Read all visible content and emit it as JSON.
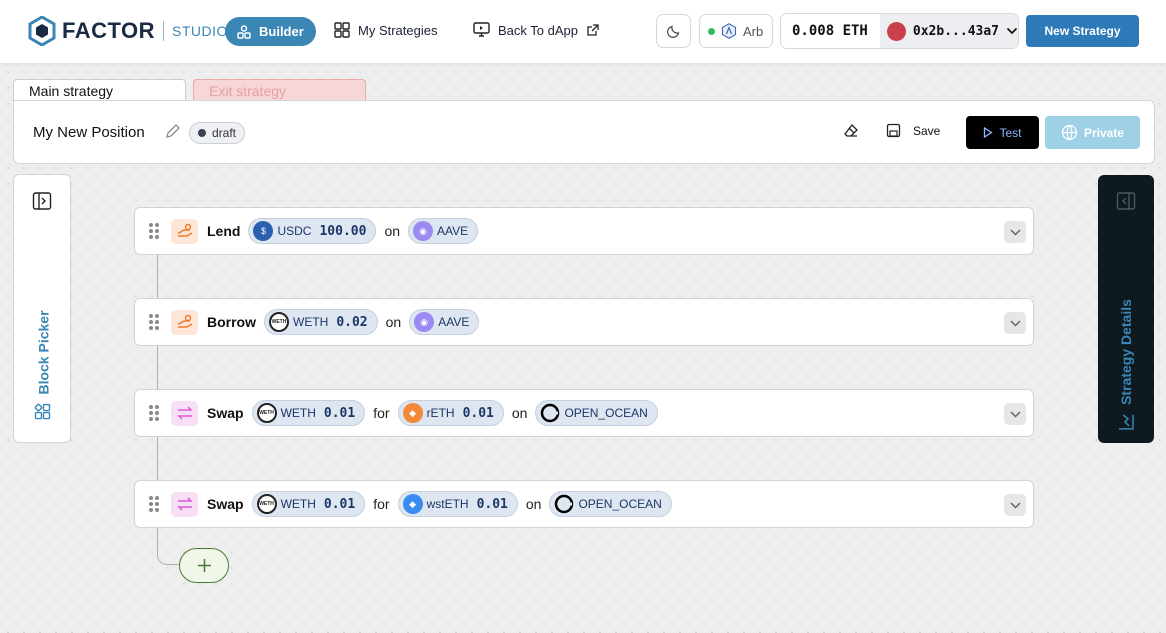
{
  "header": {
    "logo": "FACTOR",
    "logo_sub": "STUDIO",
    "nav": {
      "builder": "Builder",
      "strategies": "My Strategies",
      "back": "Back To dApp"
    },
    "network": "Arb",
    "balance": "0.008 ETH",
    "address": "0x2b...43a7",
    "new_strategy": "New Strategy"
  },
  "tabs": {
    "main": "Main strategy",
    "exit": "Exit strategy"
  },
  "strategy": {
    "title": "My New Position",
    "status": "draft",
    "save": "Save",
    "test": "Test",
    "private": "Private"
  },
  "panels": {
    "block_picker": "Block Picker",
    "strategy_details": "Strategy Details"
  },
  "blocks": [
    {
      "action": "Lend",
      "icon": "lend-icon",
      "token1": "USDC",
      "amount1": "100.00",
      "word_on": "on",
      "protocol": "AAVE"
    },
    {
      "action": "Borrow",
      "icon": "lend-icon",
      "token1": "WETH",
      "amount1": "0.02",
      "word_on": "on",
      "protocol": "AAVE"
    },
    {
      "action": "Swap",
      "icon": "swap-icon",
      "token1": "WETH",
      "amount1": "0.01",
      "word_for": "for",
      "token2": "rETH",
      "amount2": "0.01",
      "word_on": "on",
      "protocol": "OPEN_OCEAN"
    },
    {
      "action": "Swap",
      "icon": "swap-icon",
      "token1": "WETH",
      "amount1": "0.01",
      "word_for": "for",
      "token2": "wstETH",
      "amount2": "0.01",
      "word_on": "on",
      "protocol": "OPEN_OCEAN"
    }
  ],
  "token_logo_text": {
    "weth": "WETH"
  },
  "colors": {
    "brand": "#3a86b5",
    "primary_button": "#2e7ab8",
    "test_button": "#000000",
    "private_button": "#9fd1e6"
  }
}
